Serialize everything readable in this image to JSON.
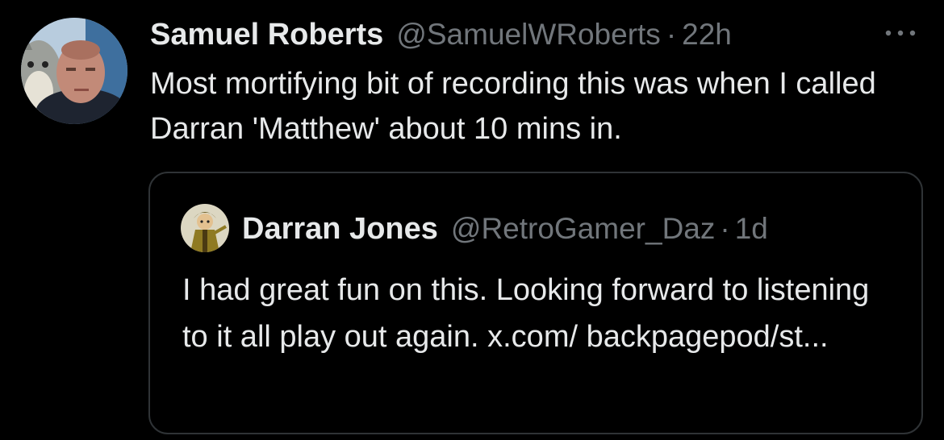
{
  "tweet": {
    "author": {
      "display_name": "Samuel Roberts",
      "handle": "@SamuelWRoberts",
      "avatar_icon": "user-avatar"
    },
    "separator": "·",
    "time": "22h",
    "more_icon": "more-horizontal-icon",
    "text": "Most mortifying bit of recording this was when I called Darran 'Matthew' about 10 mins in."
  },
  "quoted_tweet": {
    "author": {
      "display_name": "Darran Jones",
      "handle": "@RetroGamer_Daz",
      "avatar_icon": "user-avatar"
    },
    "separator": "·",
    "time": "1d",
    "text": "I had great fun on this. Looking forward to listening to it all play out again. x.com/ backpagepod/st..."
  },
  "colors": {
    "background": "#000000",
    "text_primary": "#e7e9ea",
    "text_secondary": "#71767b",
    "border": "#2f3336"
  }
}
